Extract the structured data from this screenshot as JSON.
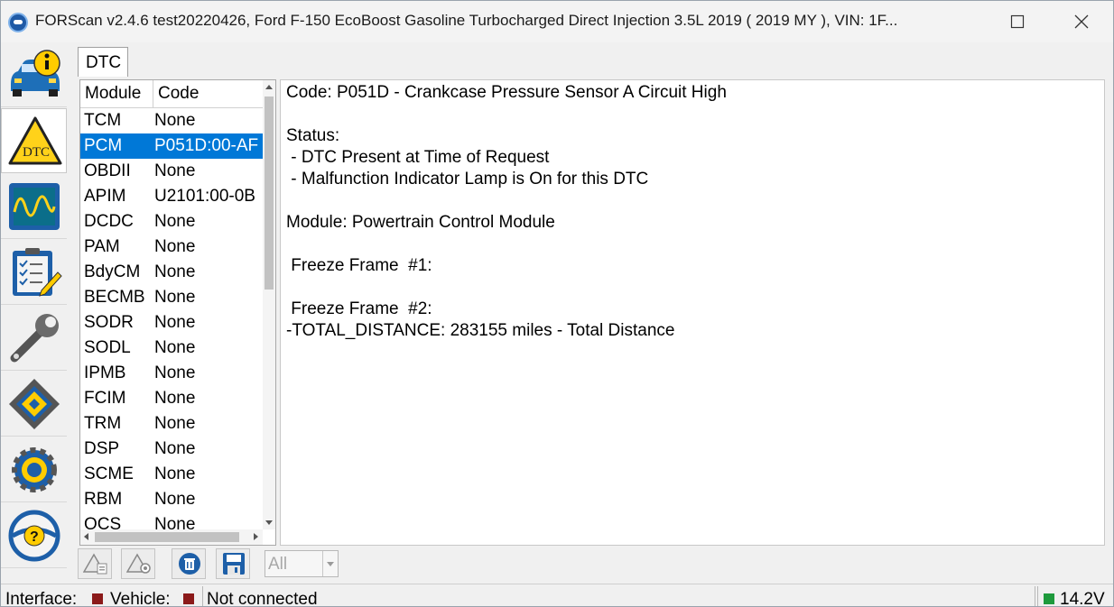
{
  "window": {
    "title": "FORScan v2.4.6 test20220426, Ford F-150 EcoBoost Gasoline Turbocharged Direct Injection 3.5L 2019 ( 2019 MY ), VIN: 1F..."
  },
  "sidebar": {
    "items": [
      {
        "name": "vehicle-info",
        "icon": "car-info-icon"
      },
      {
        "name": "dtc",
        "icon": "dtc-warning-icon",
        "label": "DTC"
      },
      {
        "name": "oscilloscope",
        "icon": "oscilloscope-icon"
      },
      {
        "name": "tests",
        "icon": "checklist-icon"
      },
      {
        "name": "service",
        "icon": "wrench-icon"
      },
      {
        "name": "configuration",
        "icon": "chip-icon"
      },
      {
        "name": "settings",
        "icon": "gear-icon"
      },
      {
        "name": "help",
        "icon": "help-icon",
        "label": "?"
      }
    ]
  },
  "tabs": [
    {
      "label": "DTC"
    }
  ],
  "dtc_list": {
    "headers": {
      "module": "Module",
      "code": "Code"
    },
    "rows": [
      {
        "module": "TCM",
        "code": "None"
      },
      {
        "module": "PCM",
        "code": "P051D:00-AF",
        "selected": true
      },
      {
        "module": "OBDII",
        "code": "None"
      },
      {
        "module": "APIM",
        "code": "U2101:00-0B"
      },
      {
        "module": "DCDC",
        "code": "None"
      },
      {
        "module": "PAM",
        "code": "None"
      },
      {
        "module": "BdyCM",
        "code": "None"
      },
      {
        "module": "BECMB",
        "code": "None"
      },
      {
        "module": "SODR",
        "code": "None"
      },
      {
        "module": "SODL",
        "code": "None"
      },
      {
        "module": "IPMB",
        "code": "None"
      },
      {
        "module": "FCIM",
        "code": "None"
      },
      {
        "module": "TRM",
        "code": "None"
      },
      {
        "module": "DSP",
        "code": "None"
      },
      {
        "module": "SCME",
        "code": "None"
      },
      {
        "module": "RBM",
        "code": "None"
      },
      {
        "module": "OCS",
        "code": "None"
      }
    ]
  },
  "details": {
    "code_line": "Code: P051D - Crankcase Pressure Sensor A Circuit High",
    "status_label": "Status:",
    "status_1": " - DTC Present at Time of Request",
    "status_2": " - Malfunction Indicator Lamp is On for this DTC",
    "module_line": "Module: Powertrain Control Module",
    "freeze_1": " Freeze Frame  #1:",
    "freeze_2": " Freeze Frame  #2:",
    "distance_line": "-TOTAL_DISTANCE: 283155 miles - Total Distance"
  },
  "toolbar": {
    "filter": {
      "selected": "All"
    }
  },
  "status_bar": {
    "interface_label": "Interface:",
    "vehicle_label": "Vehicle:",
    "connection_status": "Not connected",
    "voltage": "14.2V",
    "colors": {
      "interface_led": "#8b1a1a",
      "vehicle_led": "#8b1a1a",
      "voltage_led": "#1e9a3c"
    }
  },
  "colors": {
    "selection": "#0078d7"
  }
}
